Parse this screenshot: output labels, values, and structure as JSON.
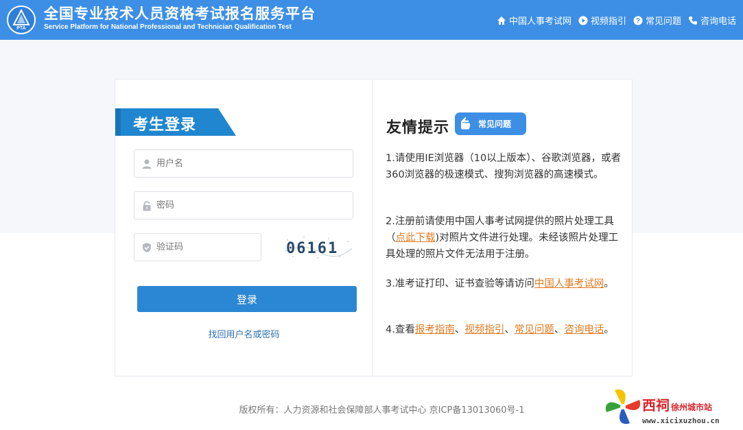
{
  "header": {
    "logo_text": "PTA",
    "title_cn": "全国专业技术人员资格考试报名服务平台",
    "title_en": "Service Platform for National Professional and Technician Qualification Test",
    "nav": [
      {
        "label": "中国人事考试网",
        "icon": "home-icon"
      },
      {
        "label": "视频指引",
        "icon": "play-icon"
      },
      {
        "label": "常见问题",
        "icon": "question-icon"
      },
      {
        "label": "咨询电话",
        "icon": "phone-icon"
      }
    ]
  },
  "login": {
    "tab_label": "考生登录",
    "username_placeholder": "用户名",
    "password_placeholder": "密码",
    "captcha_placeholder": "验证码",
    "captcha_text": "06161",
    "login_button": "登录",
    "recover_link": "找回用户名或密码"
  },
  "tips": {
    "title": "友情提示",
    "faq_badge": "常见问题",
    "tip1": "1.请使用IE浏览器（10以上版本）、谷歌浏览器，或者360浏览器的极速模式、搜狗浏览器的高速模式。",
    "tip2_before": "2.注册前请使用中国人事考试网提供的照片处理工具（",
    "tip2_link": "点此下载",
    "tip2_after": ")对照片文件进行处理。未经该照片处理工具处理的照片文件无法用于注册。",
    "tip3_before": "3.准考证打印、证书查验等请访问",
    "tip3_link": "中国人事考试网",
    "tip3_after": "。",
    "tip4_before": "4.查看",
    "tip4_link1": "报考指南",
    "tip4_sep1": "、",
    "tip4_link2": "视频指引",
    "tip4_sep2": "、",
    "tip4_link3": "常见问题",
    "tip4_sep3": "、",
    "tip4_link4": "咨询电话",
    "tip4_after": "。"
  },
  "footer": {
    "copyright": "版权所有：人力资源和社会保障部人事考试中心 京ICP备13013060号-1"
  },
  "watermark": {
    "brand": "西祠",
    "city": "徐州城市站",
    "url": "www.xicixuzhou.cn"
  },
  "colors": {
    "header_bg": "#3d8fe6",
    "button_bg": "#2b87d3",
    "link_orange": "#e07a22"
  }
}
